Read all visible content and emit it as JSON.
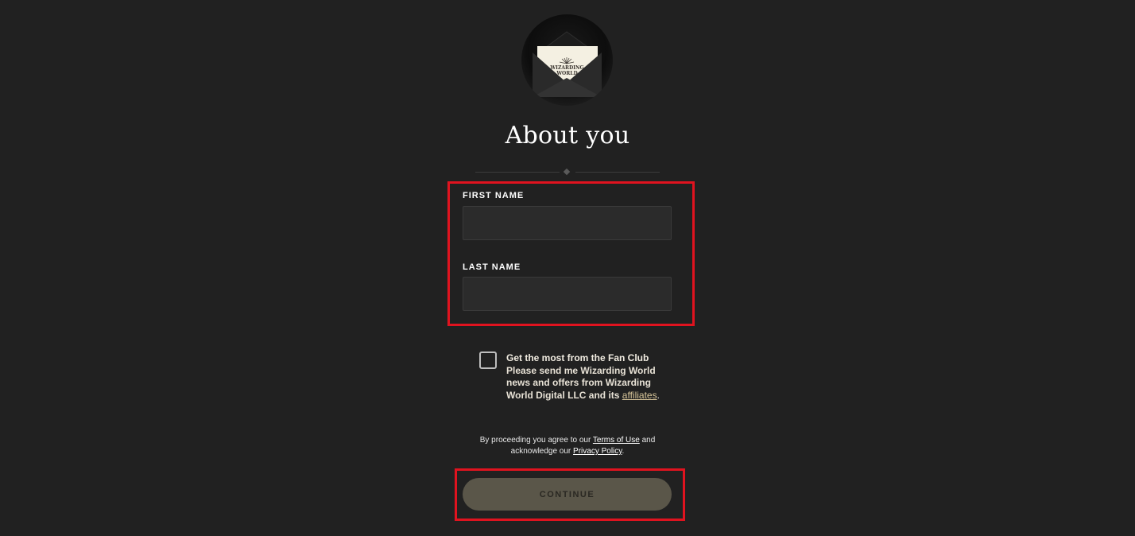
{
  "avatar": {
    "icon": "envelope-icon",
    "logo_line1": "WIZARDING",
    "logo_line2": "WORLD"
  },
  "page_title": "About you",
  "form": {
    "first_name_label": "FIRST NAME",
    "first_name_value": "",
    "last_name_label": "LAST NAME",
    "last_name_value": ""
  },
  "optin": {
    "checked": false,
    "heading": "Get the most from the Fan Club",
    "body": "Please send me Wizarding World news and offers from Wizarding World Digital LLC and its",
    "link_text": "affiliates",
    "suffix": "."
  },
  "legal": {
    "prefix": "By proceeding you agree to our",
    "terms_link": "Terms of Use",
    "middle": "and",
    "line2_prefix": "acknowledge our",
    "privacy_link": "Privacy Policy",
    "suffix": "."
  },
  "continue_label": "CONTINUE",
  "colors": {
    "background": "#212121",
    "highlight": "#e0131f",
    "button": "#5a5649",
    "link_gold": "#d8c69a"
  }
}
